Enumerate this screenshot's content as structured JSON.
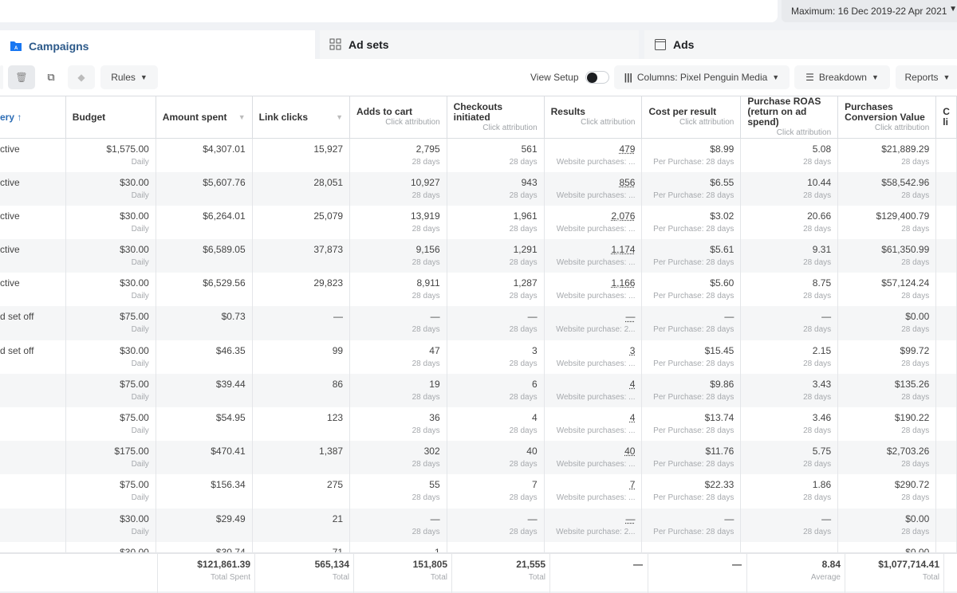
{
  "header": {
    "date_range": "Maximum: 16 Dec 2019-22 Apr 2021"
  },
  "tabs": [
    {
      "label": "Campaigns",
      "icon": "folder-icon"
    },
    {
      "label": "Ad sets",
      "icon": "grid-icon"
    },
    {
      "label": "Ads",
      "icon": "ad-icon"
    }
  ],
  "toolbar": {
    "rules": "Rules",
    "view_setup": "View Setup",
    "view_setup_on": false,
    "columns": "Columns: Pixel Penguin Media",
    "breakdown": "Breakdown",
    "reports": "Reports"
  },
  "columns": [
    {
      "label": "ery ↑",
      "sub": ""
    },
    {
      "label": "Budget",
      "sub": ""
    },
    {
      "label": "Amount spent",
      "sub": ""
    },
    {
      "label": "Link clicks",
      "sub": ""
    },
    {
      "label": "Adds to cart",
      "sub": "Click attribution"
    },
    {
      "label": "Checkouts initiated",
      "sub": "Click attribution"
    },
    {
      "label": "Results",
      "sub": "Click attribution"
    },
    {
      "label": "Cost per result",
      "sub": "Click attribution"
    },
    {
      "label": "Purchase ROAS (return on ad spend)",
      "sub": "Click attribution"
    },
    {
      "label": "Purchases Conversion Value",
      "sub": "Click attribution"
    },
    {
      "label": "C li",
      "sub": ""
    }
  ],
  "rows": [
    {
      "delivery": "ctive",
      "budget": "$1,575.00",
      "budget_sub": "Daily",
      "amount": "$4,307.01",
      "link": "15,927",
      "adds": "2,795",
      "adds_sub": "28 days",
      "checkouts": "561",
      "checkouts_sub": "28 days",
      "results": "479",
      "results_sub": "Website purchases: ...",
      "cost": "$8.99",
      "cost_sub": "Per Purchase: 28 days",
      "roas": "5.08",
      "roas_sub": "28 days",
      "value": "$21,889.29",
      "value_sub": "28 days"
    },
    {
      "delivery": "ctive",
      "budget": "$30.00",
      "budget_sub": "Daily",
      "amount": "$5,607.76",
      "link": "28,051",
      "adds": "10,927",
      "adds_sub": "28 days",
      "checkouts": "943",
      "checkouts_sub": "28 days",
      "results": "856",
      "results_sub": "Website purchases: ...",
      "cost": "$6.55",
      "cost_sub": "Per Purchase: 28 days",
      "roas": "10.44",
      "roas_sub": "28 days",
      "value": "$58,542.96",
      "value_sub": "28 days"
    },
    {
      "delivery": "ctive",
      "budget": "$30.00",
      "budget_sub": "Daily",
      "amount": "$6,264.01",
      "link": "25,079",
      "adds": "13,919",
      "adds_sub": "28 days",
      "checkouts": "1,961",
      "checkouts_sub": "28 days",
      "results": "2,076",
      "results_sub": "Website purchases: ...",
      "cost": "$3.02",
      "cost_sub": "Per Purchase: 28 days",
      "roas": "20.66",
      "roas_sub": "28 days",
      "value": "$129,400.79",
      "value_sub": "28 days"
    },
    {
      "delivery": "ctive",
      "budget": "$30.00",
      "budget_sub": "Daily",
      "amount": "$6,589.05",
      "link": "37,873",
      "adds": "9,156",
      "adds_sub": "28 days",
      "checkouts": "1,291",
      "checkouts_sub": "28 days",
      "results": "1,174",
      "results_sub": "Website purchases: ...",
      "cost": "$5.61",
      "cost_sub": "Per Purchase: 28 days",
      "roas": "9.31",
      "roas_sub": "28 days",
      "value": "$61,350.99",
      "value_sub": "28 days"
    },
    {
      "delivery": "ctive",
      "budget": "$30.00",
      "budget_sub": "Daily",
      "amount": "$6,529.56",
      "link": "29,823",
      "adds": "8,911",
      "adds_sub": "28 days",
      "checkouts": "1,287",
      "checkouts_sub": "28 days",
      "results": "1,166",
      "results_sub": "Website purchases: ...",
      "cost": "$5.60",
      "cost_sub": "Per Purchase: 28 days",
      "roas": "8.75",
      "roas_sub": "28 days",
      "value": "$57,124.24",
      "value_sub": "28 days"
    },
    {
      "delivery": "d set off",
      "budget": "$75.00",
      "budget_sub": "Daily",
      "amount": "$0.73",
      "link": "—",
      "adds": "—",
      "adds_sub": "28 days",
      "checkouts": "—",
      "checkouts_sub": "28 days",
      "results": "—",
      "results_sub": "Website purchase: 2...",
      "cost": "—",
      "cost_sub": "Per Purchase: 28 days",
      "roas": "—",
      "roas_sub": "28 days",
      "value": "$0.00",
      "value_sub": "28 days"
    },
    {
      "delivery": "d set off",
      "budget": "$30.00",
      "budget_sub": "Daily",
      "amount": "$46.35",
      "link": "99",
      "adds": "47",
      "adds_sub": "28 days",
      "checkouts": "3",
      "checkouts_sub": "28 days",
      "results": "3",
      "results_sub": "Website purchases: ...",
      "cost": "$15.45",
      "cost_sub": "Per Purchase: 28 days",
      "roas": "2.15",
      "roas_sub": "28 days",
      "value": "$99.72",
      "value_sub": "28 days"
    },
    {
      "delivery": "",
      "budget": "$75.00",
      "budget_sub": "Daily",
      "amount": "$39.44",
      "link": "86",
      "adds": "19",
      "adds_sub": "28 days",
      "checkouts": "6",
      "checkouts_sub": "28 days",
      "results": "4",
      "results_sub": "Website purchases: ...",
      "cost": "$9.86",
      "cost_sub": "Per Purchase: 28 days",
      "roas": "3.43",
      "roas_sub": "28 days",
      "value": "$135.26",
      "value_sub": "28 days"
    },
    {
      "delivery": "",
      "budget": "$75.00",
      "budget_sub": "Daily",
      "amount": "$54.95",
      "link": "123",
      "adds": "36",
      "adds_sub": "28 days",
      "checkouts": "4",
      "checkouts_sub": "28 days",
      "results": "4",
      "results_sub": "Website purchases: ...",
      "cost": "$13.74",
      "cost_sub": "Per Purchase: 28 days",
      "roas": "3.46",
      "roas_sub": "28 days",
      "value": "$190.22",
      "value_sub": "28 days"
    },
    {
      "delivery": "",
      "budget": "$175.00",
      "budget_sub": "Daily",
      "amount": "$470.41",
      "link": "1,387",
      "adds": "302",
      "adds_sub": "28 days",
      "checkouts": "40",
      "checkouts_sub": "28 days",
      "results": "40",
      "results_sub": "Website purchases: ...",
      "cost": "$11.76",
      "cost_sub": "Per Purchase: 28 days",
      "roas": "5.75",
      "roas_sub": "28 days",
      "value": "$2,703.26",
      "value_sub": "28 days"
    },
    {
      "delivery": "",
      "budget": "$75.00",
      "budget_sub": "Daily",
      "amount": "$156.34",
      "link": "275",
      "adds": "55",
      "adds_sub": "28 days",
      "checkouts": "7",
      "checkouts_sub": "28 days",
      "results": "7",
      "results_sub": "Website purchases: ...",
      "cost": "$22.33",
      "cost_sub": "Per Purchase: 28 days",
      "roas": "1.86",
      "roas_sub": "28 days",
      "value": "$290.72",
      "value_sub": "28 days"
    },
    {
      "delivery": "",
      "budget": "$30.00",
      "budget_sub": "Daily",
      "amount": "$29.49",
      "link": "21",
      "adds": "—",
      "adds_sub": "28 days",
      "checkouts": "—",
      "checkouts_sub": "28 days",
      "results": "—",
      "results_sub": "Website purchase: 2...",
      "cost": "—",
      "cost_sub": "Per Purchase: 28 days",
      "roas": "—",
      "roas_sub": "28 days",
      "value": "$0.00",
      "value_sub": "28 days"
    },
    {
      "delivery": "",
      "budget": "$30.00",
      "budget_sub": "",
      "amount": "$30.74",
      "link": "71",
      "adds": "1",
      "adds_sub": "",
      "checkouts": "—",
      "checkouts_sub": "",
      "results": "—",
      "results_sub": "",
      "cost": "—",
      "cost_sub": "",
      "roas": "—",
      "roas_sub": "",
      "value": "$0.00",
      "value_sub": ""
    }
  ],
  "totals": {
    "amount": "$121,861.39",
    "amount_sub": "Total Spent",
    "link": "565,134",
    "link_sub": "Total",
    "adds": "151,805",
    "adds_sub": "Total",
    "checkouts": "21,555",
    "checkouts_sub": "Total",
    "results": "—",
    "cost": "—",
    "roas": "8.84",
    "roas_sub": "Average",
    "value": "$1,077,714.41",
    "value_sub": "Total"
  }
}
